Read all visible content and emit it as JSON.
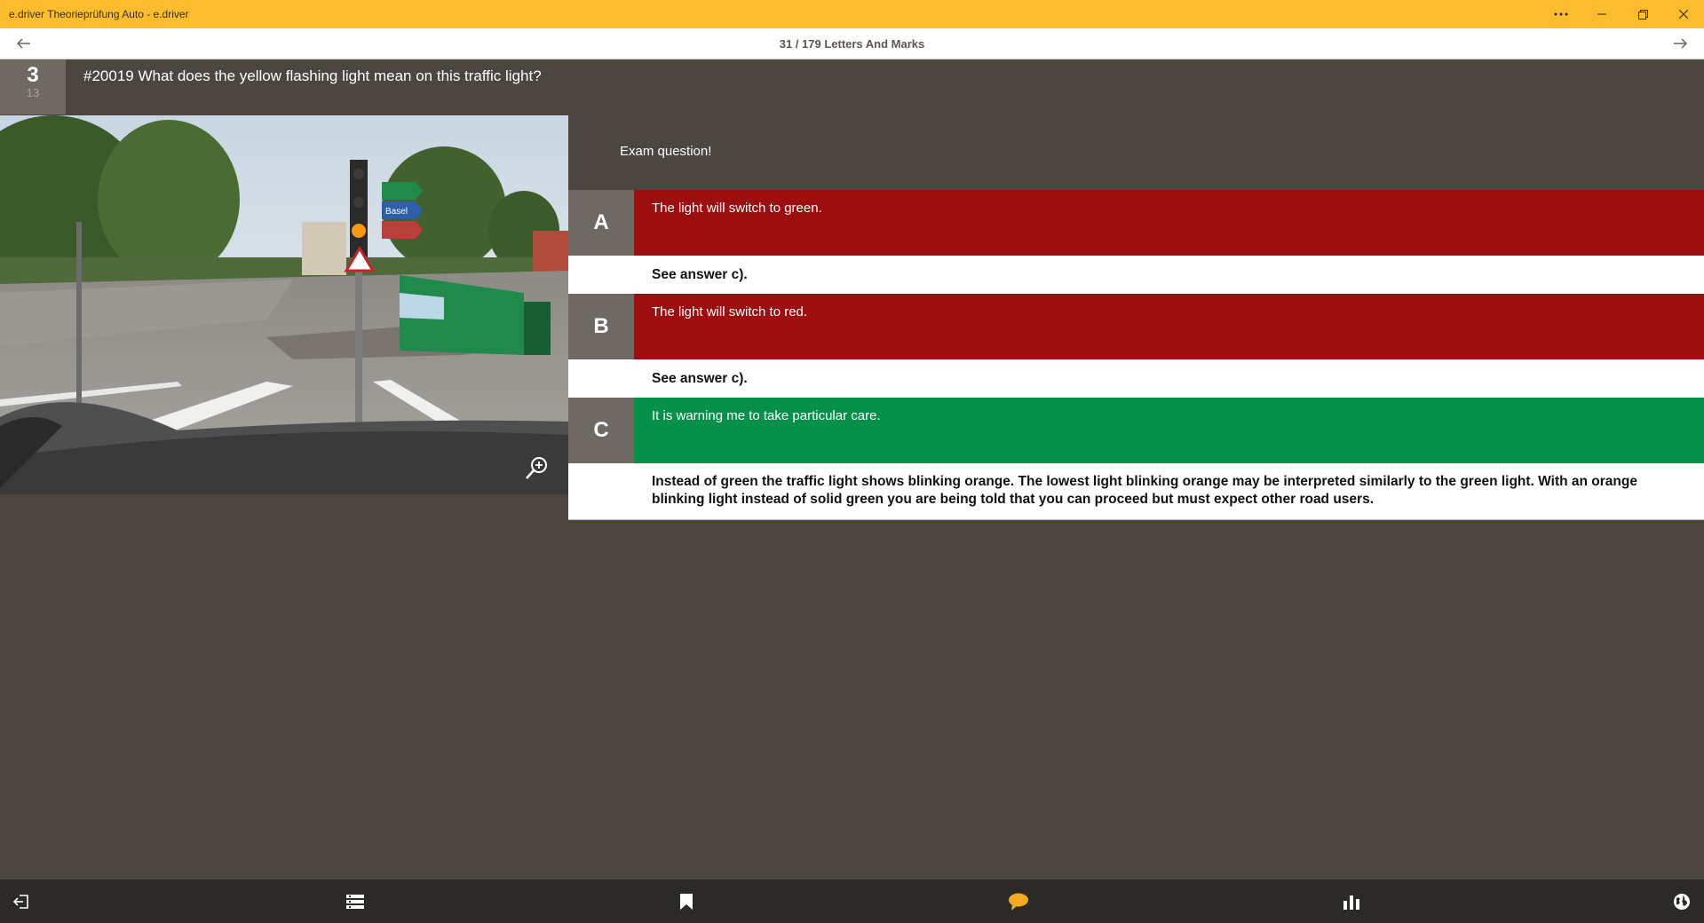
{
  "window": {
    "title": "e.driver Theorieprüfung Auto - e.driver",
    "buttons": [
      "more-options",
      "minimize",
      "maximize",
      "close"
    ]
  },
  "nav": {
    "title": "31 / 179 Letters And Marks"
  },
  "question": {
    "number": "3",
    "sub_number": "13",
    "text": "#20019 What does the yellow flashing light mean on this traffic light?"
  },
  "photo": {
    "sign_labels": [
      "Basel"
    ]
  },
  "exam_label": "Exam question!",
  "answers": [
    {
      "letter": "A",
      "text": "The light will switch to green.",
      "status": "wrong",
      "explanation": "See answer c)."
    },
    {
      "letter": "B",
      "text": "The light will switch to red.",
      "status": "wrong",
      "explanation": "See answer c)."
    },
    {
      "letter": "C",
      "text": "It is warning me to take particular care.",
      "status": "correct",
      "explanation": "Instead of green the traffic light shows blinking orange. The lowest light blinking orange may be interpreted similarly to the green light. With an orange blinking light instead of solid green you are being told that you can proceed but must expect other road users."
    }
  ],
  "colors": {
    "accent": "#fbbc2e",
    "wrong": "#9c0e10",
    "correct": "#07904a",
    "background": "#4b4640",
    "comment_icon": "#f4a91e"
  },
  "bottom_bar": {
    "icons": [
      "exit-icon",
      "list-icon",
      "bookmark-icon",
      "comment-icon",
      "statistics-icon",
      "globe-icon"
    ]
  }
}
